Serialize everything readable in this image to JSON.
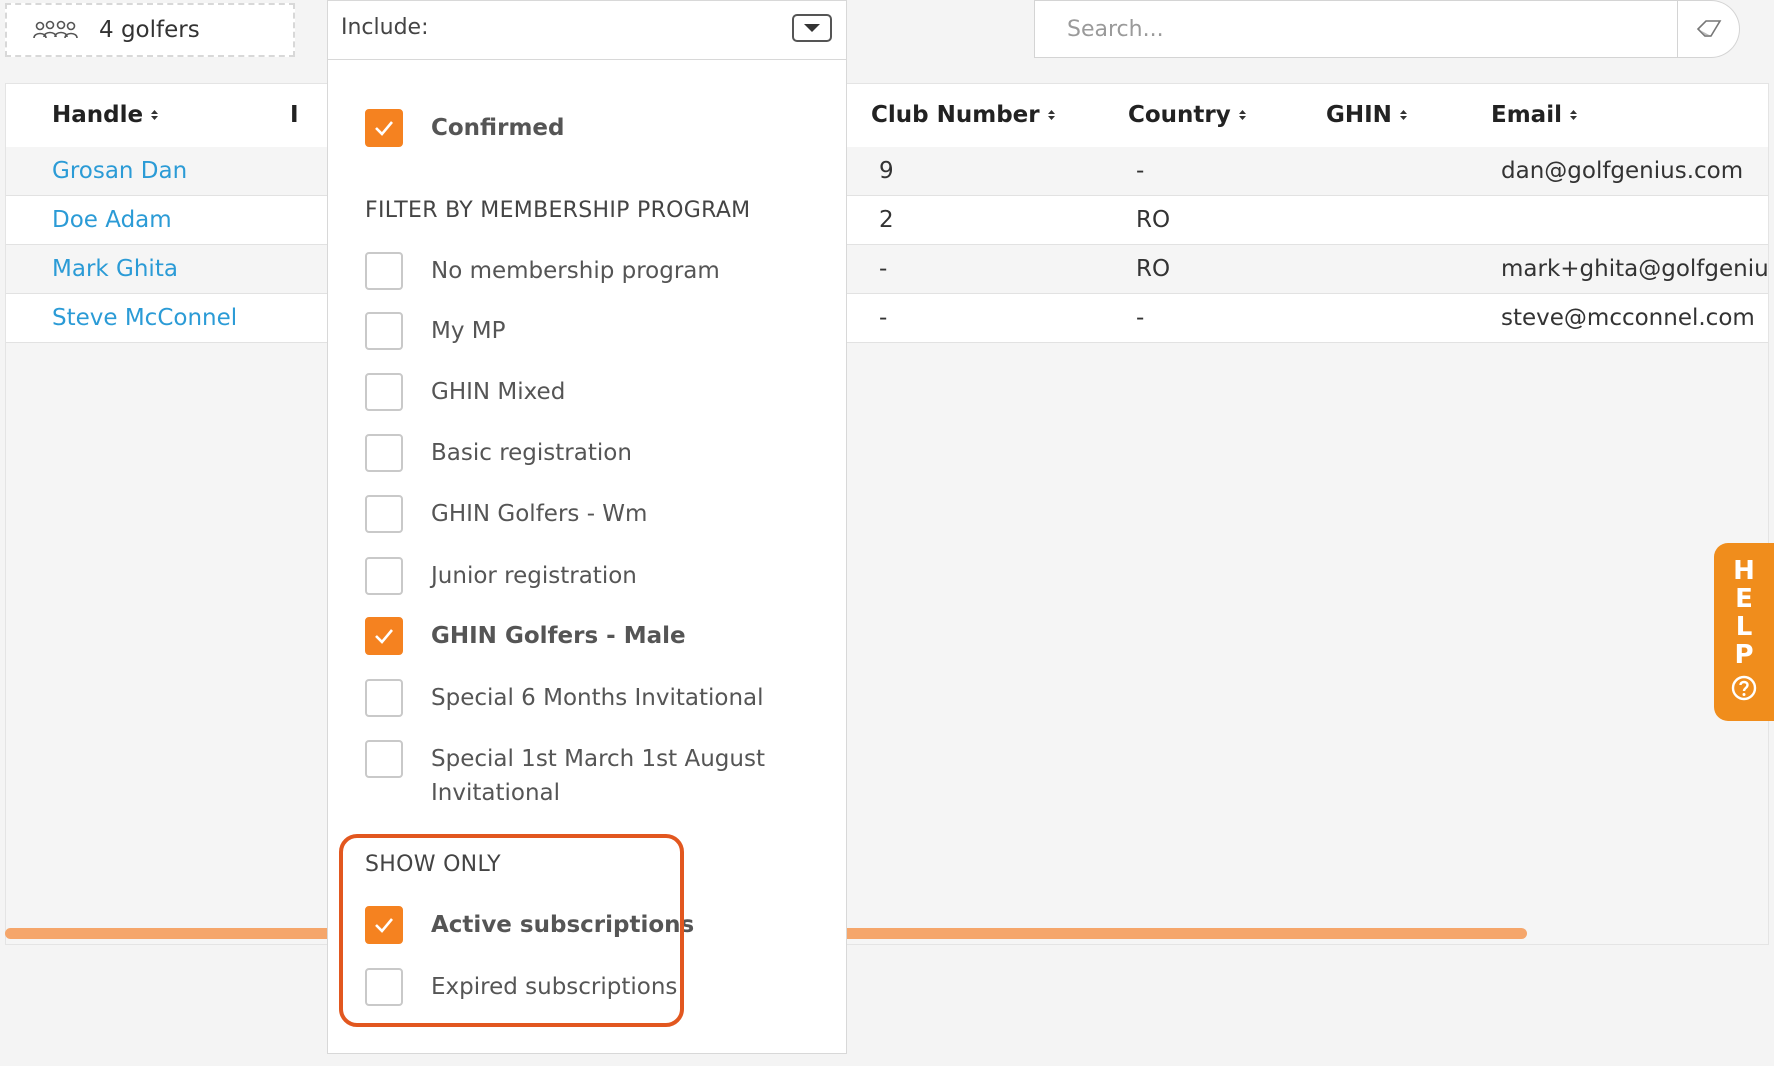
{
  "topbar": {
    "golfers_count": "4 golfers",
    "search_placeholder": "Search..."
  },
  "table": {
    "headers": [
      "Handle",
      "Club Number",
      "Country",
      "GHIN",
      "Email"
    ],
    "rows": [
      {
        "handle": "Grosan Dan",
        "club_number": "9",
        "country": "-",
        "ghin": "",
        "email": "dan@golfgenius.com"
      },
      {
        "handle": "Doe Adam",
        "club_number": "2",
        "country": "RO",
        "ghin": "",
        "email": ""
      },
      {
        "handle": "Mark Ghita",
        "club_number": "-",
        "country": "RO",
        "ghin": "",
        "email": "mark+ghita@golfgenius."
      },
      {
        "handle": "Steve McConnel",
        "club_number": "-",
        "country": "-",
        "ghin": "",
        "email": "steve@mcconnel.com"
      }
    ]
  },
  "include_dropdown": {
    "label": "Include:",
    "confirmed": {
      "label": "Confirmed",
      "checked": true
    },
    "membership_section_title": "FILTER BY MEMBERSHIP PROGRAM",
    "membership_options": [
      {
        "label": "No membership program",
        "checked": false
      },
      {
        "label": "My MP",
        "checked": false
      },
      {
        "label": "GHIN Mixed",
        "checked": false
      },
      {
        "label": "Basic registration",
        "checked": false
      },
      {
        "label": "GHIN Golfers - Wm",
        "checked": false
      },
      {
        "label": "Junior registration",
        "checked": false
      },
      {
        "label": "GHIN Golfers - Male",
        "checked": true
      },
      {
        "label": "Special 6 Months Invitational",
        "checked": false
      },
      {
        "label": "Special 1st March 1st August Invitational",
        "checked": false
      }
    ],
    "show_only_title": "SHOW ONLY",
    "show_only_options": [
      {
        "label": "Active subscriptions",
        "checked": true
      },
      {
        "label": "Expired subscriptions",
        "checked": false
      }
    ]
  },
  "help_tab": {
    "letters": [
      "H",
      "E",
      "L",
      "P"
    ]
  },
  "colors": {
    "accent": "#f58220",
    "link": "#2b9bd6",
    "highlight": "#e2571f",
    "scrollbar": "#f5a66b"
  }
}
